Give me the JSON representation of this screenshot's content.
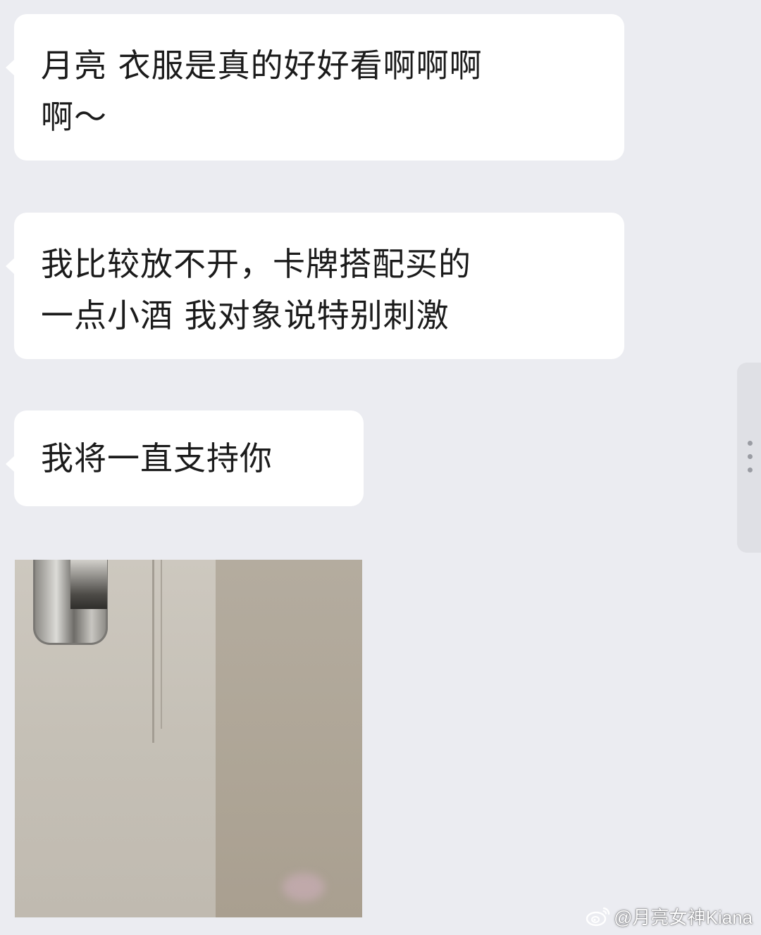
{
  "messages": [
    {
      "lines": [
        "月亮 衣服是真的好好看啊啊啊",
        "啊～"
      ]
    },
    {
      "lines": [
        "我比较放不开，卡牌搭配买的",
        "一点小酒 我对象说特别刺激"
      ]
    },
    {
      "lines": [
        "我将一直支持你"
      ]
    }
  ],
  "photo": {
    "description_icon": "image-thumbnail"
  },
  "side_handle": {
    "icon": "more-vertical-icon"
  },
  "watermark": {
    "icon": "weibo-icon",
    "text": "@月亮女神Kiana"
  },
  "colors": {
    "background": "#ebecf1",
    "bubble": "#ffffff",
    "text": "#1b1b1b"
  }
}
